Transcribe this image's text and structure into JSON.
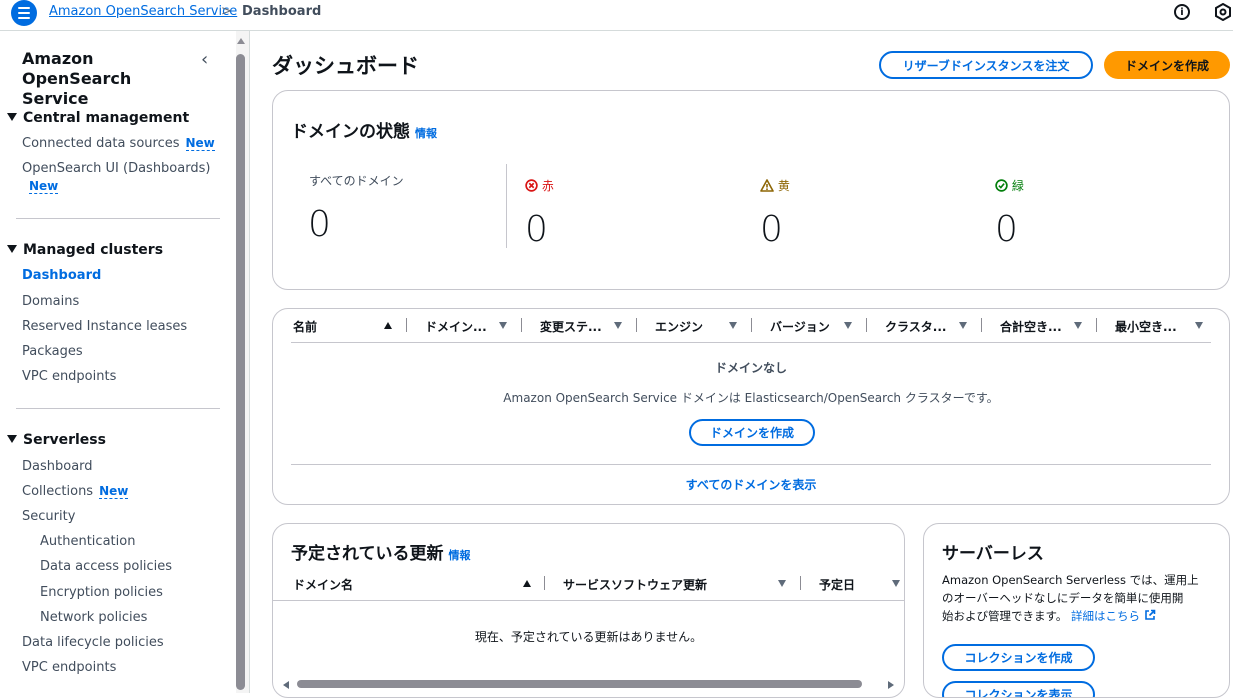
{
  "topbar": {
    "breadcrumb_service": "Amazon OpenSearch Service",
    "breadcrumb_separator": ">",
    "breadcrumb_current": "Dashboard",
    "info_icon_glyph": "i"
  },
  "sidebar": {
    "title": "Amazon OpenSearch Service",
    "collapse_glyph": "‹",
    "central_management": {
      "heading": "Central management",
      "items": [
        {
          "label": "Connected data sources",
          "badge": "New"
        },
        {
          "label": "OpenSearch UI (Dashboards)",
          "badge": "New"
        }
      ]
    },
    "managed_clusters": {
      "heading": "Managed clusters",
      "items": [
        "Dashboard",
        "Domains",
        "Reserved Instance leases",
        "Packages",
        "VPC endpoints"
      ]
    },
    "serverless": {
      "heading": "Serverless",
      "items": [
        "Dashboard",
        "Collections",
        "Security",
        "Authentication",
        "Data access policies",
        "Encryption policies",
        "Network policies",
        "Data lifecycle policies",
        "VPC endpoints"
      ],
      "collections_badge": "New"
    }
  },
  "main": {
    "title": "ダッシュボード",
    "reserve_button": "リザーブドインスタンスを注文",
    "create_domain_button": "ドメインを作成",
    "domain_status": {
      "title": "ドメインの状態",
      "info": "情報",
      "all_label": "すべてのドメイン",
      "all_value": "0",
      "red_label": "赤",
      "red_value": "0",
      "yellow_label": "黄",
      "yellow_value": "0",
      "green_label": "緑",
      "green_value": "0",
      "colors": {
        "red": "#d91515",
        "yellow": "#8d6605",
        "green": "#037f0c"
      }
    },
    "domains_table": {
      "columns": [
        "名前",
        "ドメイン...",
        "変更ステ...",
        "エンジン",
        "バージョン",
        "クラスタ...",
        "合計空き...",
        "最小空き..."
      ],
      "empty_title": "ドメインなし",
      "empty_desc": "Amazon OpenSearch Service ドメインは Elasticsearch/OpenSearch クラスターです。",
      "create_button": "ドメインを作成",
      "view_all": "すべてのドメインを表示"
    },
    "scheduled_updates": {
      "title": "予定されている更新",
      "info": "情報",
      "columns": [
        "ドメイン名",
        "サービスソフトウェア更新",
        "予定日"
      ],
      "empty_text": "現在、予定されている更新はありません。"
    },
    "serverless_card": {
      "title": "サーバーレス",
      "desc_line1": "Amazon OpenSearch Serverless では、運用上",
      "desc_line2": "のオーバーヘッドなしにデータを簡単に使用開",
      "desc_line3": "始および管理できます。",
      "details_link": "詳細はこちら",
      "create_collection": "コレクションを作成",
      "view_collections": "コレクションを表示"
    }
  },
  "accent": "#006ce0",
  "primary_button_color": "#ff9900"
}
